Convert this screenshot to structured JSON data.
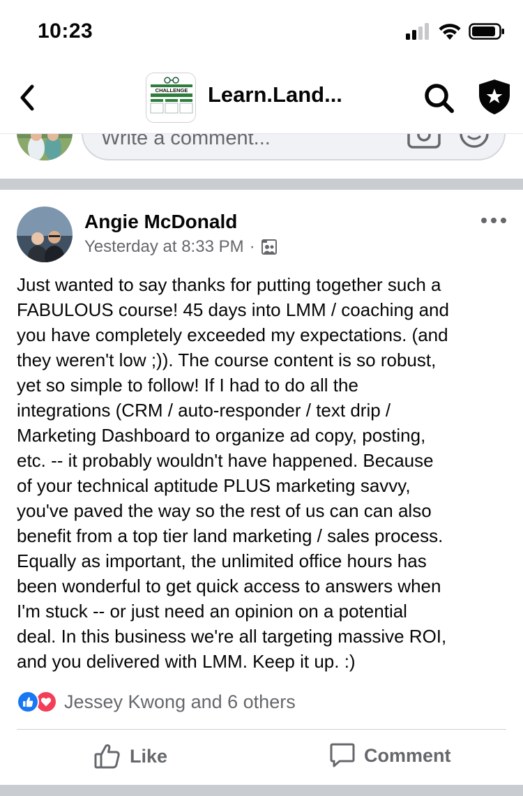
{
  "status_bar": {
    "time": "10:23",
    "icons": [
      "signal-icon",
      "wifi-icon",
      "battery-icon"
    ]
  },
  "header": {
    "group_title": "Learn.Land...",
    "group_thumb_text": "CHALLENGE",
    "icons": [
      "back-arrow-icon",
      "search-icon",
      "shield-star-icon"
    ]
  },
  "comment_box": {
    "placeholder": "Write a comment..."
  },
  "post": {
    "author": "Angie McDonald",
    "timestamp": "Yesterday at 8:33 PM",
    "separator": "·",
    "audience_icon": "group-members-icon",
    "body_lines": [
      "Just wanted to say thanks for putting together such a",
      "FABULOUS course!   45 days into LMM / coaching and",
      "you have completely exceeded my expectations.  (and",
      "they weren't low ;)). The course content is so robust,",
      "yet so simple to follow!  If I had to do all the",
      "integrations (CRM / auto-responder / text drip /",
      "Marketing Dashboard to organize ad copy, posting,",
      "etc. -- it probably wouldn't have happened.  Because",
      "of your technical aptitude PLUS marketing savvy,",
      "you've paved the way so the rest of us can can also",
      "benefit from a top tier land marketing / sales process.",
      "Equally as important, the unlimited office hours has",
      "been wonderful to get quick access to answers when",
      "I'm stuck -- or just need an opinion on a potential",
      "deal.  In this business we're all targeting massive ROI,",
      "and you delivered with LMM.  Keep it up.  :)"
    ],
    "reactions_text": "Jessey Kwong and 6 others",
    "like_label": "Like",
    "comment_label": "Comment"
  },
  "colors": {
    "facebook_blue": "#1877f2",
    "love_red": "#f33e58",
    "secondary_text": "#65676b",
    "divider_band": "#c9ccd1"
  }
}
